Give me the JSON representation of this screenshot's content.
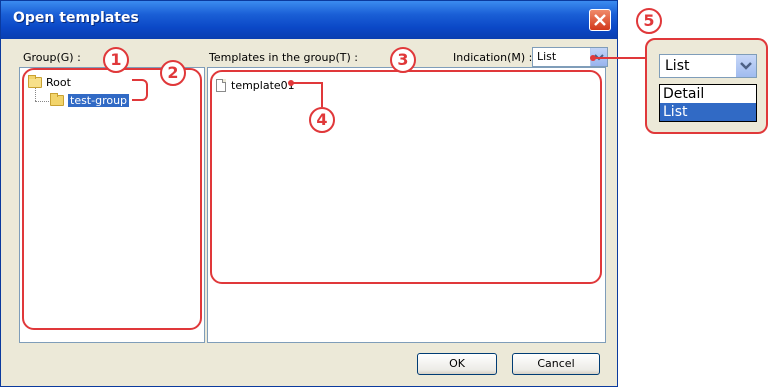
{
  "dialog": {
    "title": "Open templates",
    "group_label": "Group(G) :",
    "templates_label": "Templates in the group(T) :",
    "indication_label": "Indication(M) :",
    "indication_value": "List",
    "tree": {
      "root": "Root",
      "child": "test-group"
    },
    "templates": [
      "template01"
    ],
    "ok_label": "OK",
    "cancel_label": "Cancel"
  },
  "dropdown_callout": {
    "selected": "List",
    "options": [
      "Detail",
      "List"
    ]
  },
  "annotations": [
    "1",
    "2",
    "3",
    "4",
    "5"
  ],
  "colors": {
    "titlebar": "#0b48c7",
    "dialog_bg": "#ece9d8",
    "selection": "#316ac5",
    "annotation": "#e0383a"
  }
}
